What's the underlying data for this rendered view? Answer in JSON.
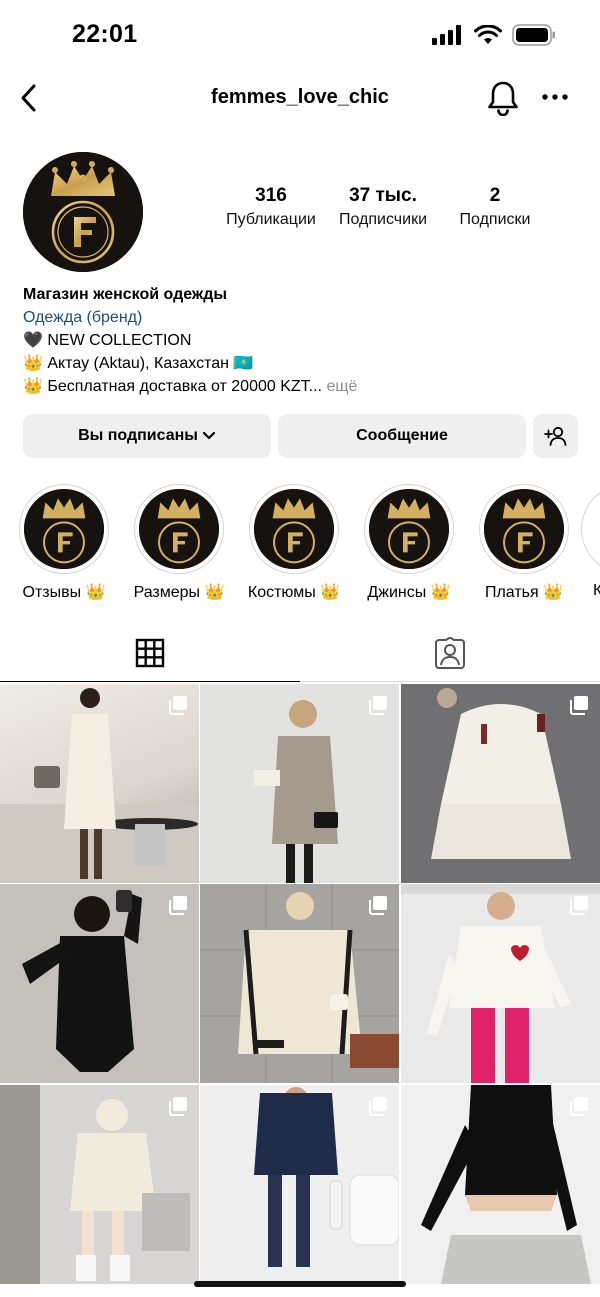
{
  "status": {
    "time": "22:01"
  },
  "nav": {
    "username": "femmes_love_chic",
    "icons": [
      "back-chevron-icon",
      "bell-icon",
      "more-horizontal-icon"
    ]
  },
  "profile": {
    "stats": [
      {
        "value": "316",
        "label": "Публикации"
      },
      {
        "value": "37 тыс.",
        "label": "Подписчики"
      },
      {
        "value": "2",
        "label": "Подписки"
      }
    ],
    "bio": {
      "name": "Магазин женской одежды",
      "category": "Одежда (бренд)",
      "line1": "🖤 NEW COLLECTION",
      "line2": "👑 Актау (Aktau), Казахстан 🇰🇿",
      "line3": "👑 Бесплатная доставка от 20000 KZT...",
      "more": "ещё"
    }
  },
  "actions": {
    "following": "Вы подписаны",
    "message": "Сообщение"
  },
  "highlights": [
    {
      "label": "Отзывы 👑"
    },
    {
      "label": "Размеры 👑"
    },
    {
      "label": "Костюмы 👑"
    },
    {
      "label": "Джинсы 👑"
    },
    {
      "label": "Платья 👑"
    },
    {
      "label": "К"
    }
  ],
  "tabs": [
    "grid-icon",
    "tagged-icon"
  ],
  "colors": {
    "accent_link": "#1c4d7f",
    "button_bg": "#efefef",
    "logo_gold": "#d4af5f",
    "logo_dark": "#151210"
  }
}
